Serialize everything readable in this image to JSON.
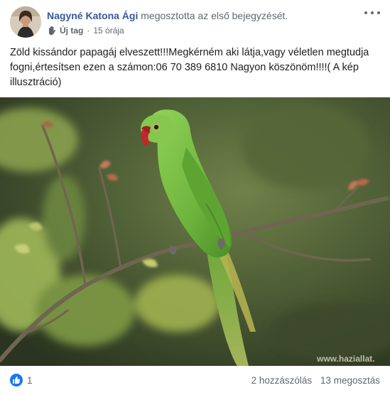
{
  "post": {
    "author_name": "Nagyné Katona Ági",
    "action_text": "megosztotta az első bejegyzését.",
    "tag_label": "Új tag",
    "separator": "·",
    "time": "15 órája",
    "text": "Zöld kissándor papagáj elveszett!!!Megkérném aki látja,vagy véletlen megtudja fogni,értesítsen ezen a számon:06 70 389 6810 Nagyon köszönöm!!!!( A kép illusztráció)",
    "image_watermark": "www.haziallat.",
    "reaction_count": "1",
    "comments": "2 hozzászólás",
    "shares": "13 megosztás"
  },
  "colors": {
    "author": "#385898",
    "secondary_text": "#606770",
    "like_blue": "#1877f2",
    "parrot_green": "#7dc244"
  },
  "icons": {
    "more": "more-dots-icon",
    "new_member": "wave-hand-icon",
    "like": "thumbs-up-icon"
  }
}
